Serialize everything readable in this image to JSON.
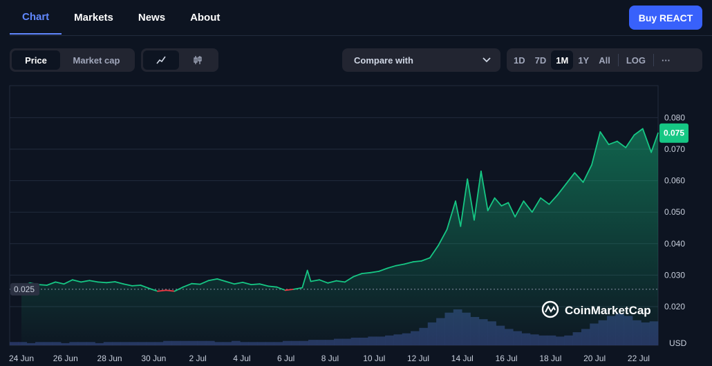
{
  "nav": {
    "tabs": [
      {
        "label": "Chart",
        "active": true
      },
      {
        "label": "Markets",
        "active": false
      },
      {
        "label": "News",
        "active": false
      },
      {
        "label": "About",
        "active": false
      }
    ],
    "buy_label": "Buy REACT"
  },
  "toolbar": {
    "metric_options": [
      "Price",
      "Market cap"
    ],
    "metric_selected": "Price",
    "chart_style_icons": [
      "line-chart-icon",
      "candlestick-icon"
    ],
    "chart_style_selected": "line-chart-icon",
    "compare_label": "Compare with",
    "ranges": [
      "1D",
      "7D",
      "1M",
      "1Y",
      "All",
      "LOG"
    ],
    "range_selected": "1M",
    "more_label": "···"
  },
  "colors": {
    "accent": "#3861fb",
    "tab_active": "#6188ff",
    "up": "#16c784",
    "down": "#ea3943",
    "volume": "#2c3a6b"
  },
  "chart_data": {
    "type": "line",
    "ylabel_unit": "USD",
    "y_ticks": [
      "0.080",
      "0.070",
      "0.060",
      "0.050",
      "0.040",
      "0.030",
      "0.020"
    ],
    "ylim": [
      0.012,
      0.09
    ],
    "x_ticks": [
      "24 Jun",
      "26 Jun",
      "28 Jun",
      "30 Jun",
      "2 Jul",
      "4 Jul",
      "6 Jul",
      "8 Jul",
      "10 Jul",
      "12 Jul",
      "14 Jul",
      "16 Jul",
      "18 Jul",
      "20 Jul",
      "22 Jul"
    ],
    "reference_price": 0.0255,
    "reference_label": "0.025",
    "current_price": 0.0751,
    "current_label": "0.075",
    "grid": true,
    "price_series": [
      {
        "x": 0,
        "y": 0.0265
      },
      {
        "x": 0.5,
        "y": 0.0275
      },
      {
        "x": 1,
        "y": 0.027
      },
      {
        "x": 1.5,
        "y": 0.0268
      },
      {
        "x": 2,
        "y": 0.0278
      },
      {
        "x": 2.5,
        "y": 0.0272
      },
      {
        "x": 3,
        "y": 0.0285
      },
      {
        "x": 3.5,
        "y": 0.0278
      },
      {
        "x": 4,
        "y": 0.0283
      },
      {
        "x": 4.5,
        "y": 0.0278
      },
      {
        "x": 5,
        "y": 0.0276
      },
      {
        "x": 5.5,
        "y": 0.0279
      },
      {
        "x": 6,
        "y": 0.0272
      },
      {
        "x": 6.5,
        "y": 0.0266
      },
      {
        "x": 7,
        "y": 0.0268
      },
      {
        "x": 7.5,
        "y": 0.0258
      },
      {
        "x": 8,
        "y": 0.0249
      },
      {
        "x": 8.5,
        "y": 0.0252
      },
      {
        "x": 9,
        "y": 0.0249
      },
      {
        "x": 9.5,
        "y": 0.0262
      },
      {
        "x": 10,
        "y": 0.0273
      },
      {
        "x": 10.5,
        "y": 0.0271
      },
      {
        "x": 11,
        "y": 0.0283
      },
      {
        "x": 11.5,
        "y": 0.0288
      },
      {
        "x": 12,
        "y": 0.028
      },
      {
        "x": 12.5,
        "y": 0.0272
      },
      {
        "x": 13,
        "y": 0.0277
      },
      {
        "x": 13.5,
        "y": 0.027
      },
      {
        "x": 14,
        "y": 0.0272
      },
      {
        "x": 14.5,
        "y": 0.0265
      },
      {
        "x": 15,
        "y": 0.0262
      },
      {
        "x": 15.5,
        "y": 0.0252
      },
      {
        "x": 16,
        "y": 0.0255
      },
      {
        "x": 16.5,
        "y": 0.026
      },
      {
        "x": 16.8,
        "y": 0.0315
      },
      {
        "x": 17,
        "y": 0.028
      },
      {
        "x": 17.5,
        "y": 0.0285
      },
      {
        "x": 18,
        "y": 0.0275
      },
      {
        "x": 18.5,
        "y": 0.0282
      },
      {
        "x": 19,
        "y": 0.0278
      },
      {
        "x": 19.5,
        "y": 0.0295
      },
      {
        "x": 20,
        "y": 0.0305
      },
      {
        "x": 20.5,
        "y": 0.0308
      },
      {
        "x": 21,
        "y": 0.0312
      },
      {
        "x": 21.5,
        "y": 0.0322
      },
      {
        "x": 22,
        "y": 0.033
      },
      {
        "x": 22.5,
        "y": 0.0335
      },
      {
        "x": 23,
        "y": 0.0342
      },
      {
        "x": 23.5,
        "y": 0.0345
      },
      {
        "x": 24,
        "y": 0.0355
      },
      {
        "x": 24.5,
        "y": 0.0395
      },
      {
        "x": 25,
        "y": 0.0445
      },
      {
        "x": 25.5,
        "y": 0.0535
      },
      {
        "x": 25.8,
        "y": 0.0455
      },
      {
        "x": 26.2,
        "y": 0.0605
      },
      {
        "x": 26.6,
        "y": 0.0475
      },
      {
        "x": 27,
        "y": 0.063
      },
      {
        "x": 27.4,
        "y": 0.0505
      },
      {
        "x": 27.8,
        "y": 0.0545
      },
      {
        "x": 28.2,
        "y": 0.052
      },
      {
        "x": 28.6,
        "y": 0.053
      },
      {
        "x": 29,
        "y": 0.0485
      },
      {
        "x": 29.5,
        "y": 0.0535
      },
      {
        "x": 30,
        "y": 0.05
      },
      {
        "x": 30.5,
        "y": 0.0545
      },
      {
        "x": 31,
        "y": 0.0525
      },
      {
        "x": 31.5,
        "y": 0.0555
      },
      {
        "x": 32,
        "y": 0.059
      },
      {
        "x": 32.5,
        "y": 0.0625
      },
      {
        "x": 33,
        "y": 0.0595
      },
      {
        "x": 33.5,
        "y": 0.065
      },
      {
        "x": 34,
        "y": 0.0755
      },
      {
        "x": 34.5,
        "y": 0.0715
      },
      {
        "x": 35,
        "y": 0.0725
      },
      {
        "x": 35.5,
        "y": 0.0705
      },
      {
        "x": 36,
        "y": 0.0745
      },
      {
        "x": 36.5,
        "y": 0.0765
      },
      {
        "x": 37,
        "y": 0.069
      },
      {
        "x": 37.4,
        "y": 0.0751
      }
    ],
    "volume_series": [
      3,
      3,
      2,
      3,
      3,
      3,
      2,
      3,
      3,
      3,
      2,
      3,
      3,
      3,
      3,
      3,
      3,
      3,
      4,
      4,
      4,
      4,
      4,
      4,
      3,
      3,
      4,
      3,
      3,
      3,
      3,
      3,
      4,
      4,
      4,
      5,
      5,
      5,
      6,
      6,
      7,
      7,
      8,
      8,
      9,
      10,
      11,
      13,
      16,
      21,
      25,
      30,
      33,
      30,
      26,
      24,
      22,
      18,
      15,
      13,
      11,
      10,
      9,
      9,
      8,
      9,
      12,
      15,
      20,
      23,
      27,
      29,
      27,
      23,
      21,
      22
    ]
  },
  "watermark": {
    "text": "CoinMarketCap"
  }
}
